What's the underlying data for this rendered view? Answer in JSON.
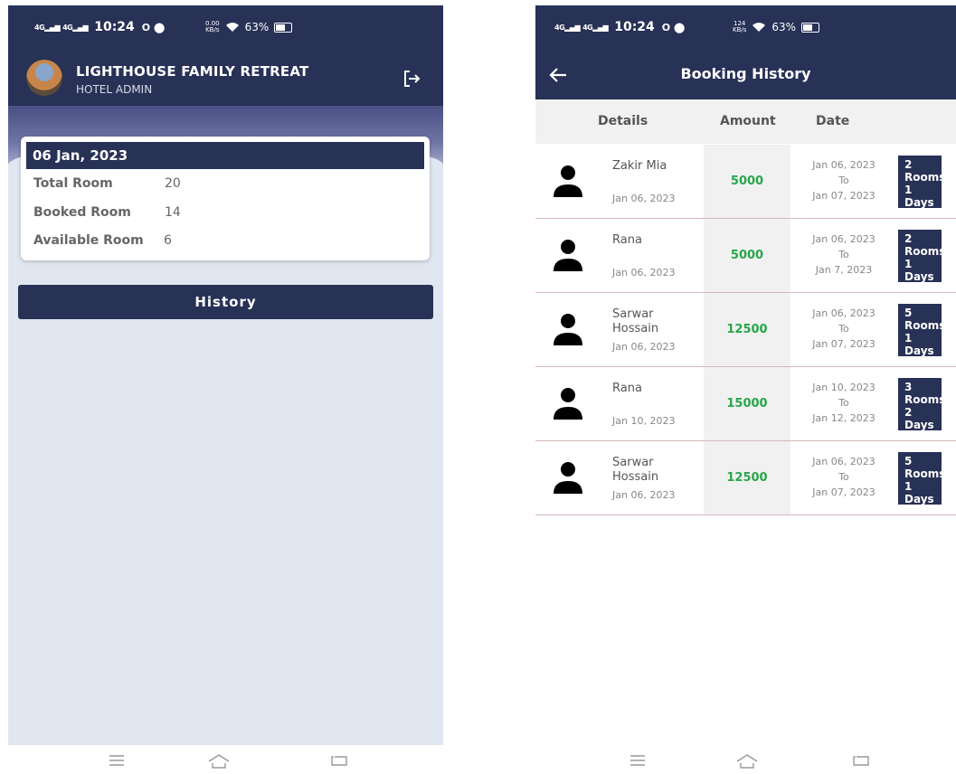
{
  "status_left": {
    "net1": "4G",
    "net2": "4G",
    "time": "10:24",
    "dots": "O ⬤",
    "speed_top": "0.00",
    "speed_bottom": "KB/s",
    "battery": "63%"
  },
  "status_right": {
    "net1": "4G",
    "net2": "4G",
    "time": "10:24",
    "dots": "O ⬤",
    "speed_top": "124",
    "speed_bottom": "KB/s",
    "battery": "63%"
  },
  "left": {
    "hotel_name": "LIGHTHOUSE FAMILY RETREAT",
    "role": "HOTEL ADMIN",
    "summary": {
      "date": "06 Jan, 2023",
      "rows": [
        {
          "label": "Total Room",
          "value": "20"
        },
        {
          "label": "Booked Room",
          "value": "14"
        },
        {
          "label": "Available Room",
          "value": "6"
        }
      ]
    },
    "history_button": "History"
  },
  "right": {
    "title": "Booking History",
    "columns": {
      "details": "Details",
      "amount": "Amount",
      "date": "Date"
    },
    "bookings": [
      {
        "name": "Zakir Mia",
        "booked_on": "Jan 06, 2023",
        "amount": "5000",
        "from": "Jan 06, 2023",
        "to_label": "To",
        "to": "Jan 07, 2023",
        "rooms_count": "2",
        "rooms_label": "Rooms",
        "days": "1 Days"
      },
      {
        "name": "Rana",
        "booked_on": "Jan 06, 2023",
        "amount": "5000",
        "from": "Jan 06, 2023",
        "to_label": "To",
        "to": "Jan 7, 2023",
        "rooms_count": "2",
        "rooms_label": "Rooms",
        "days": "1 Days"
      },
      {
        "name": "Sarwar Hossain",
        "booked_on": "Jan 06, 2023",
        "amount": "12500",
        "from": "Jan 06, 2023",
        "to_label": "To",
        "to": "Jan 07, 2023",
        "rooms_count": "5",
        "rooms_label": "Rooms",
        "days": "1 Days"
      },
      {
        "name": "Rana",
        "booked_on": "Jan 10, 2023",
        "amount": "15000",
        "from": "Jan 10, 2023",
        "to_label": "To",
        "to": "Jan 12, 2023",
        "rooms_count": "3",
        "rooms_label": "Rooms",
        "days": "2 Days"
      },
      {
        "name": "Sarwar Hossain",
        "booked_on": "Jan 06, 2023",
        "amount": "12500",
        "from": "Jan 06, 2023",
        "to_label": "To",
        "to": "Jan 07, 2023",
        "rooms_count": "5",
        "rooms_label": "Rooms",
        "days": "1 Days"
      }
    ]
  },
  "icons": {
    "logout": "logout-icon",
    "back": "arrow-left-icon",
    "avatar": "person-icon",
    "menu": "menu-icon",
    "home": "home-icon",
    "back_nav": "back-icon"
  },
  "colors": {
    "primary": "#283156",
    "amount_green": "#27a64a",
    "light_bg": "#e1e7f0"
  }
}
